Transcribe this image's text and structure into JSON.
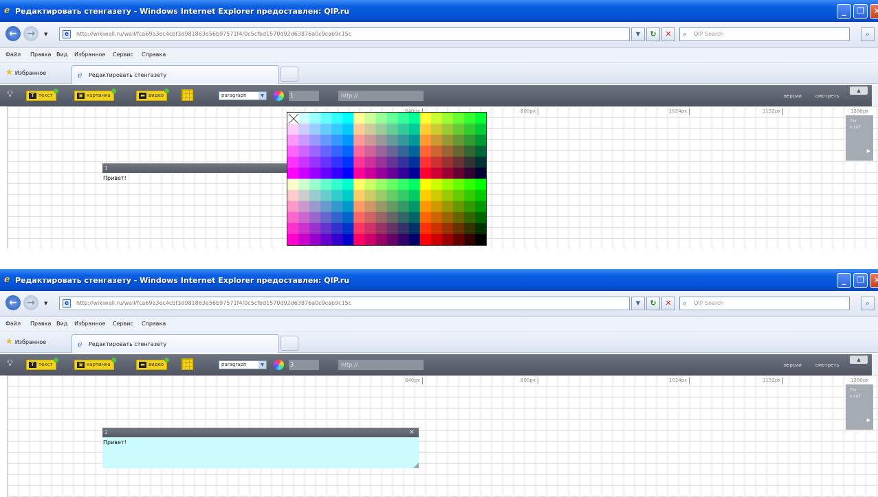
{
  "window": {
    "title": "Редактировать стенгазету - Windows Internet Explorer предоставлен: QIP.ru"
  },
  "address": {
    "url": "http://wikiwall.ru/wall/fca69a3ec4cbf3d981863e56b97571f4/0c5cfbd1570d92d63876a0c9cab9c15c"
  },
  "search": {
    "placeholder": "QIP Search"
  },
  "menu": {
    "items": [
      "Файл",
      "Правка",
      "Вид",
      "Избранное",
      "Сервис",
      "Справка"
    ]
  },
  "tabs": {
    "favorites_label": "Избранное",
    "active_tab_label": "Редактировать стенгазету"
  },
  "editor": {
    "text_button": "текст",
    "image_button": "картинка",
    "video_button": "видео",
    "paragraph_select": "paragraph",
    "size_value": "1",
    "url_placeholder": "http://",
    "versions_link": "версии",
    "view_link": "смотреть"
  },
  "rulers": [
    "640px",
    "800px",
    "1024px",
    "1152px",
    "1280px"
  ],
  "side_panel": {
    "label_line1": "Ты",
    "label_line2": "кто?"
  },
  "text_block": {
    "header": "1",
    "content": "Привет!"
  },
  "bottom_editor": {
    "size_value": "3"
  },
  "colors": {
    "titlebar": "#0553d9",
    "editor_toolbar": "#5a616b",
    "button_yellow": "#f2d21a",
    "selected_block_bg": "#ccfbfd"
  }
}
